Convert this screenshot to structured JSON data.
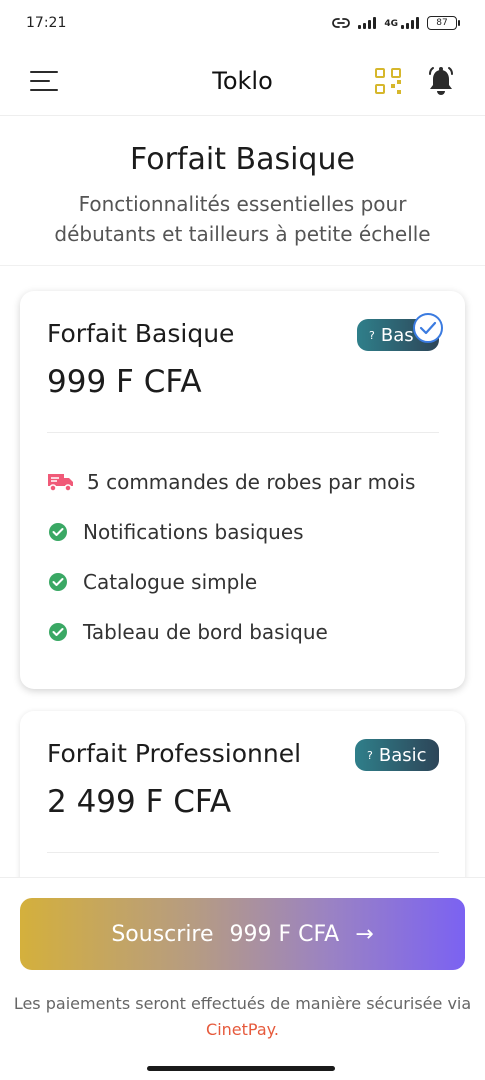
{
  "status_bar": {
    "time": "17:21",
    "network": "4G",
    "battery": "87"
  },
  "header": {
    "title": "Toklo"
  },
  "intro": {
    "title": "Forfait Basique",
    "subtitle": "Fonctionnalités essentielles pour débutants et tailleurs à petite échelle"
  },
  "plans": [
    {
      "name": "Forfait Basique",
      "price": "999 F CFA",
      "badge": "Bas",
      "badge_icon": "?",
      "selected": true,
      "features": [
        {
          "label": "5 commandes de robes par mois",
          "icon": "truck-icon"
        },
        {
          "label": "Notifications basiques",
          "icon": "check-circle-icon"
        },
        {
          "label": "Catalogue simple",
          "icon": "check-circle-icon"
        },
        {
          "label": "Tableau de bord basique",
          "icon": "check-circle-icon"
        }
      ]
    },
    {
      "name": "Forfait Professionnel",
      "price": "2 499 F CFA",
      "badge": "Basic",
      "badge_icon": "?",
      "selected": false
    }
  ],
  "subscribe": {
    "label": "Souscrire",
    "price": "999 F CFA",
    "arrow": "→"
  },
  "payment_note": {
    "text": "Les paiements seront effectués de manière sécurisée via",
    "provider": "CinetPay",
    "end": "."
  },
  "colors": {
    "accent_gold": "#d6b72c",
    "check_green": "#3aa864",
    "truck_pink": "#f05a78",
    "badge_teal": "#2f7f8a",
    "selected_blue": "#3b7be0",
    "brand_link": "#e65a3c"
  }
}
